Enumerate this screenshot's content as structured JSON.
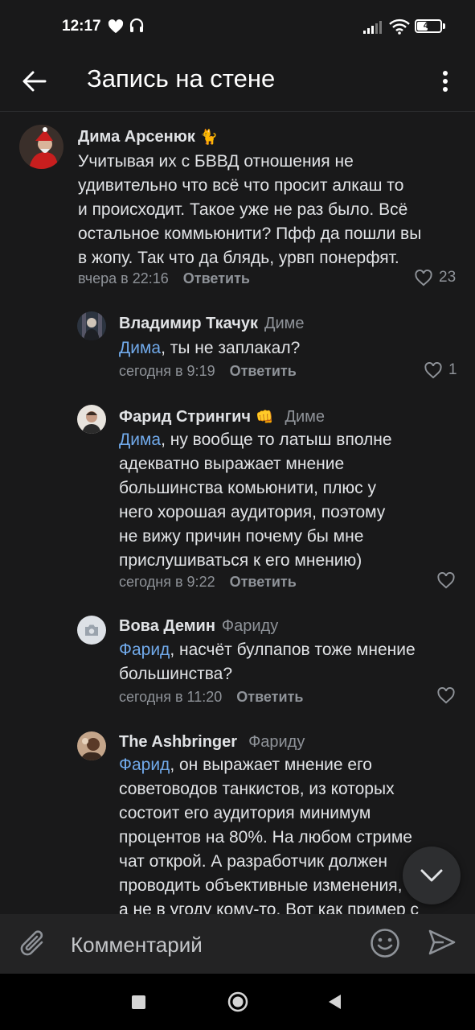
{
  "status_bar": {
    "time": "12:17",
    "battery": "42",
    "battery_level": 0.42
  },
  "header": {
    "title": "Запись на стене"
  },
  "comments": [
    {
      "author": "Дима Арсенюк",
      "badge": "🐈",
      "reply_to": "",
      "lines": [
        "Учитывая их с БВВД отношения не",
        "удивительно что всё что просит алкаш то",
        "и происходит. Такое уже не раз было. Всё",
        "остальное коммьюнити? Пфф да пошли вы",
        "в жопу. Так что да блядь, урвп понерфят."
      ],
      "time": "вчера в 22:16",
      "reply_label": "Ответить",
      "likes": "23"
    },
    {
      "author": "Владимир Ткачук",
      "reply_to": "Диме",
      "mention": "Дима",
      "lines": [
        ", ты не заплакал?"
      ],
      "time": "сегодня в 9:19",
      "reply_label": "Ответить",
      "likes": "1"
    },
    {
      "author": "Фарид Стрингич",
      "badge": "👊",
      "reply_to": "Диме",
      "mention": "Дима",
      "lines": [
        ", ну вообще то латыш вполне",
        "адекватно выражает мнение",
        "большинства комьюнити, плюс у",
        "него хорошая аудитория, поэтому",
        "не вижу причин почему бы мне",
        "прислушиваться к его мнению)"
      ],
      "time": "сегодня в 9:22",
      "reply_label": "Ответить",
      "likes": ""
    },
    {
      "author": "Вова Демин",
      "reply_to": "Фариду",
      "mention": "Фарид",
      "lines": [
        ", насчёт булпапов тоже мнение",
        "большинства?"
      ],
      "time": "сегодня в 11:20",
      "reply_label": "Ответить",
      "likes": ""
    },
    {
      "author": "The Ashbringer",
      "reply_to": "Фариду",
      "mention": "Фарид",
      "lines": [
        ", он выражает мнение его",
        "советоводов танкистов, из которых",
        "состоит его аудитория минимум",
        "процентов на 80%. На любом стриме",
        "чат открой. А разработчик должен",
        "проводить объективные изменения,",
        "а не в угоду кому-то. Вот как пример с"
      ]
    }
  ],
  "composer": {
    "placeholder": "Комментарий"
  },
  "colors": {
    "background": "#19191a",
    "link": "#71aaeb",
    "secondary": "#8f9399"
  }
}
